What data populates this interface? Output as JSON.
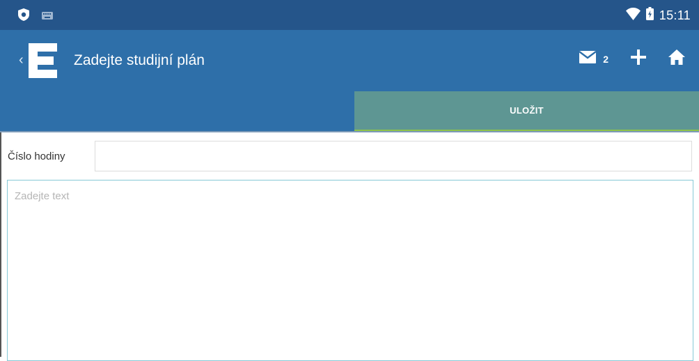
{
  "status_bar": {
    "time": "15:11",
    "left_icons": [
      "shield-icon",
      "keyboard-icon"
    ],
    "right_icons": [
      "wifi-icon",
      "battery-icon"
    ]
  },
  "app_bar": {
    "title": "Zadejte studijní plán",
    "back_glyph": "‹",
    "logo": "E",
    "messages_count": "2",
    "actions": [
      "mail-icon",
      "add-icon",
      "home-icon"
    ],
    "bar_color": "#2e6fa9"
  },
  "tabs": {
    "save_label": "ULOŽIT",
    "active_color": "#5e9693",
    "indicator_color": "#8dc34a"
  },
  "form": {
    "hour_label": "Číslo hodiny",
    "hour_value": "",
    "text_placeholder": "Zadejte text",
    "text_value": ""
  }
}
